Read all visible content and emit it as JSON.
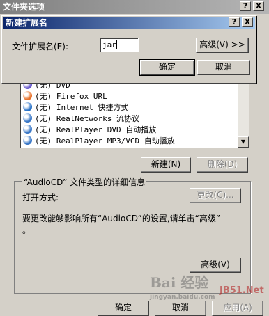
{
  "main_window": {
    "title": "文件夹选项",
    "help_btn": "?",
    "close_btn": "X"
  },
  "modal": {
    "title": "新建扩展名",
    "help_btn": "?",
    "close_btn": "X",
    "ext_label": "文件扩展名(E):",
    "ext_value": "jar",
    "advanced_btn": "高级(V) >>",
    "ok_btn": "确定",
    "cancel_btn": "取消"
  },
  "file_types": {
    "items": [
      {
        "label": "(无) DVD",
        "icon": "dvd-icon",
        "color": "#6a5acd"
      },
      {
        "label": "(无) Firefox URL",
        "icon": "firefox-icon",
        "color": "#e8712a"
      },
      {
        "label": "(无) Internet 快捷方式",
        "icon": "ie-icon",
        "color": "#2a73c9"
      },
      {
        "label": "(无) RealNetworks 流协议",
        "icon": "realplayer-icon",
        "color": "#3a78c8"
      },
      {
        "label": "(无) RealPlayer DVD 自动播放",
        "icon": "realplayer-icon",
        "color": "#3a78c8"
      },
      {
        "label": "(无) RealPlayer MP3/VCD 自动播放",
        "icon": "realplayer-icon",
        "color": "#3a78c8"
      }
    ],
    "new_btn": "新建(N)",
    "delete_btn": "删除(D)"
  },
  "details": {
    "group_title": "“AudioCD” 文件类型的详细信息",
    "open_with_label": "打开方式:",
    "change_btn": "更改(C)...",
    "info_text_1": "要更改能够影响所有“AudioCD”的设置,请单击“高级”",
    "info_text_2": "。",
    "advanced_btn": "高级(V)"
  },
  "footer": {
    "ok_btn": "确定",
    "cancel_btn": "取消",
    "apply_btn": "应用(A)"
  },
  "watermark": {
    "logo": "Bai 经验",
    "site": "JB51.Net",
    "url": "jingyan.baidu.com"
  }
}
